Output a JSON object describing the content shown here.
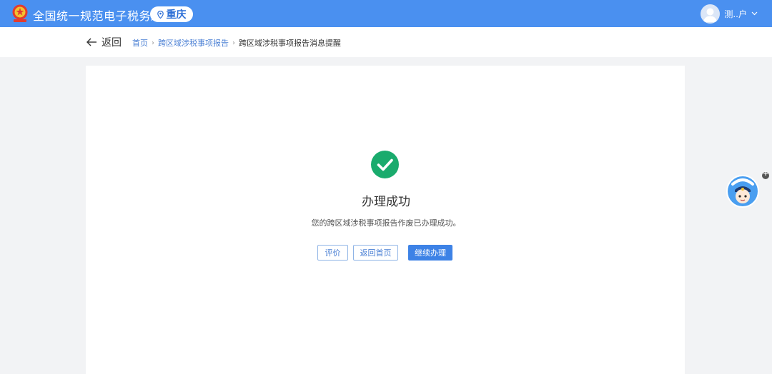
{
  "header": {
    "site_title": "全国统一规范电子税务局",
    "region": "重庆",
    "user_name": "测..户",
    "bg_color": "#4a90f0"
  },
  "breadcrumb": {
    "back_label": "返回",
    "items": [
      "首页",
      "跨区域涉税事项报告"
    ],
    "current": "跨区域涉税事项报告消息提醒"
  },
  "result": {
    "status": "success",
    "title": "办理成功",
    "description": "您的跨区域涉税事项报告作废已办理成功。"
  },
  "actions": {
    "evaluate": "评价",
    "back_home": "返回首页",
    "continue": "继续办理"
  },
  "icons": {
    "emblem": "tax-emblem-icon",
    "region": "location-pin-icon",
    "success": "check-circle-icon",
    "back": "arrow-left-icon",
    "assistant": "assistant-avatar-icon"
  },
  "colors": {
    "accent": "#3d82e6",
    "success": "#1aab6d"
  }
}
